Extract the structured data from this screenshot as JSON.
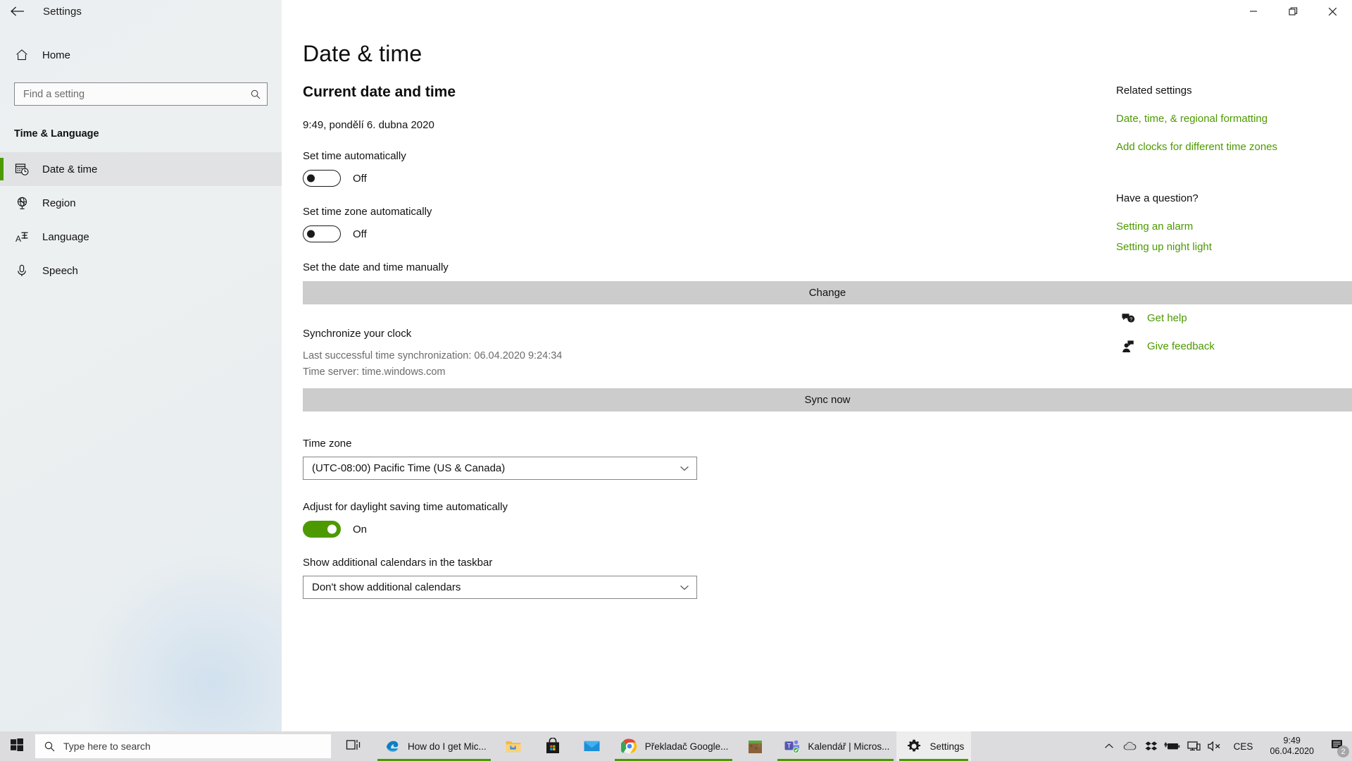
{
  "window": {
    "title": "Settings",
    "back_icon": "back-arrow-icon",
    "minimize_icon": "minimize-icon",
    "maximize_icon": "maximize-icon",
    "close_icon": "close-icon"
  },
  "sidebar": {
    "home_label": "Home",
    "home_icon": "home-icon",
    "search": {
      "placeholder": "Find a setting",
      "icon": "search-icon",
      "value": ""
    },
    "group_title": "Time & Language",
    "items": [
      {
        "label": "Date & time",
        "icon": "calendar-clock-icon",
        "selected": true
      },
      {
        "label": "Region",
        "icon": "globe-icon",
        "selected": false
      },
      {
        "label": "Language",
        "icon": "language-icon",
        "selected": false
      },
      {
        "label": "Speech",
        "icon": "microphone-icon",
        "selected": false
      }
    ]
  },
  "main": {
    "page_title": "Date & time",
    "section_heading": "Current date and time",
    "current_datetime": "9:49, pondělí 6. dubna 2020",
    "set_time_auto": {
      "label": "Set time automatically",
      "state": "Off",
      "on": false
    },
    "set_timezone_auto": {
      "label": "Set time zone automatically",
      "state": "Off",
      "on": false
    },
    "set_manually": {
      "label": "Set the date and time manually",
      "button": "Change"
    },
    "synchronize": {
      "heading": "Synchronize your clock",
      "last_sync": "Last successful time synchronization: 06.04.2020 9:24:34",
      "time_server": "Time server: time.windows.com",
      "button": "Sync now"
    },
    "time_zone": {
      "label": "Time zone",
      "value": "(UTC-08:00) Pacific Time (US & Canada)",
      "arrow_icon": "chevron-down-icon"
    },
    "daylight_saving": {
      "label": "Adjust for daylight saving time automatically",
      "state": "On",
      "on": true
    },
    "additional_calendars": {
      "label": "Show additional calendars in the taskbar",
      "value": "Don't show additional calendars",
      "arrow_icon": "chevron-down-icon"
    }
  },
  "rail": {
    "related_heading": "Related settings",
    "related_links": [
      "Date, time, & regional formatting",
      "Add clocks for different time zones"
    ],
    "question_heading": "Have a question?",
    "question_links": [
      "Setting an alarm",
      "Setting up night light"
    ],
    "support_links": [
      {
        "label": "Get help",
        "icon": "help-chat-icon"
      },
      {
        "label": "Give feedback",
        "icon": "feedback-person-icon"
      }
    ]
  },
  "taskbar": {
    "start_icon": "windows-start-icon",
    "search": {
      "placeholder": "Type here to search",
      "icon": "search-icon"
    },
    "task_view_icon": "task-view-icon",
    "items": [
      {
        "label": "How do I get Mic...",
        "icon": "edge-icon",
        "running": true,
        "active": false,
        "icon_only": false
      },
      {
        "label": "",
        "icon": "file-explorer-icon",
        "running": false,
        "active": false,
        "icon_only": true
      },
      {
        "label": "",
        "icon": "microsoft-store-icon",
        "running": false,
        "active": false,
        "icon_only": true
      },
      {
        "label": "",
        "icon": "mail-icon",
        "running": false,
        "active": false,
        "icon_only": true
      },
      {
        "label": "Překladač Google...",
        "icon": "chrome-icon",
        "running": true,
        "active": false,
        "icon_only": false
      },
      {
        "label": "",
        "icon": "minecraft-icon",
        "running": false,
        "active": false,
        "icon_only": true
      },
      {
        "label": "Kalendář | Micros...",
        "icon": "teams-icon",
        "running": true,
        "active": false,
        "icon_only": false
      },
      {
        "label": "Settings",
        "icon": "gear-icon",
        "running": true,
        "active": true,
        "icon_only": false
      }
    ],
    "tray": {
      "overflow_icon": "chevron-up-icon",
      "icons": [
        "onedrive-icon",
        "dropbox-icon",
        "battery-charging-icon",
        "network-icon",
        "volume-muted-icon"
      ],
      "language": "CES",
      "clock_time": "9:49",
      "clock_date": "06.04.2020",
      "notification_icon": "notification-icon",
      "notification_count": "2"
    }
  },
  "colors": {
    "accent_green": "#4c9a00",
    "taskbar_bg": "#dcdcdf",
    "sidebar_bg": "#eceff1",
    "button_bg": "#cccccc"
  }
}
